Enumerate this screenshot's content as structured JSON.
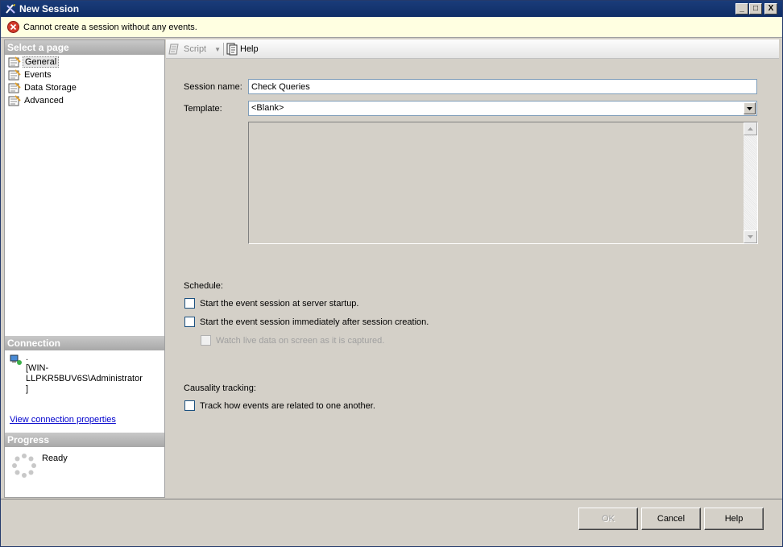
{
  "window": {
    "title": "New Session",
    "minimize": "_",
    "maximize": "□",
    "close": "X"
  },
  "message": {
    "text": "Cannot create a session without any events."
  },
  "left": {
    "select_header": "Select a page",
    "pages": [
      {
        "label": "General",
        "selected": true
      },
      {
        "label": "Events"
      },
      {
        "label": "Data Storage"
      },
      {
        "label": "Advanced"
      }
    ],
    "connection_header": "Connection",
    "connection_dot": ".",
    "connection_user": "[WIN-LLPKR5BUV6S\\Administrator",
    "connection_close": "]",
    "view_props": "View connection properties",
    "progress_header": "Progress",
    "progress_status": "Ready"
  },
  "toolbar": {
    "script": "Script",
    "help": "Help"
  },
  "form": {
    "session_name_label": "Session name:",
    "session_name_value": "Check Queries",
    "template_label": "Template:",
    "template_value": "<Blank>",
    "schedule_label": "Schedule:",
    "opt_startup": "Start the event session at server startup.",
    "opt_immediate": "Start the event session immediately after session creation.",
    "opt_watch": "Watch live data on screen as it is captured.",
    "causality_label": "Causality tracking:",
    "opt_track": "Track how events are related to one another."
  },
  "buttons": {
    "ok": "OK",
    "cancel": "Cancel",
    "help": "Help"
  }
}
